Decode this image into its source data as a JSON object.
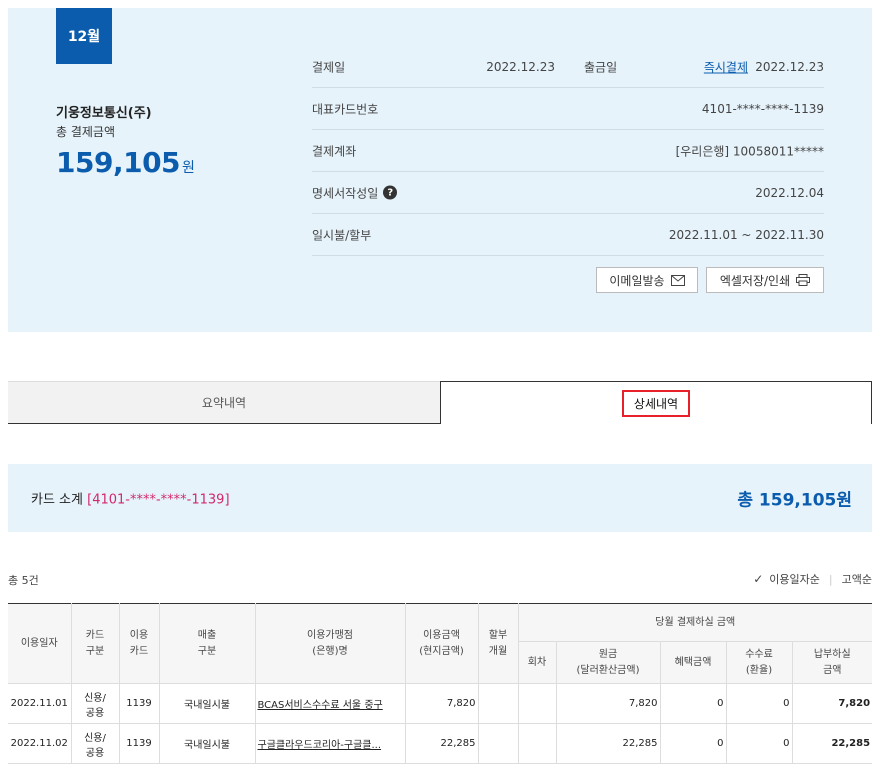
{
  "summary": {
    "month": "12월",
    "company": "기웅정보통신(주)",
    "total_label": "총 결제금액",
    "total_amount": "159,105",
    "total_unit": "원",
    "rows": {
      "pay_date_label": "결제일",
      "pay_date_value": "2022.12.23",
      "withdraw_label": "출금일",
      "withdraw_link": "즉시결제",
      "withdraw_value": "2022.12.23",
      "card_label": "대표카드번호",
      "card_value": "4101-****-****-1139",
      "account_label": "결제계좌",
      "account_value": "[우리은행] 10058011*****",
      "statement_label": "명세서작성일",
      "statement_value": "2022.12.04",
      "period_label": "일시불/할부",
      "period_value": "2022.11.01 ~ 2022.11.30"
    },
    "email_button": "이메일발송",
    "excel_button": "엑셀저장/인쇄"
  },
  "tabs": {
    "summary": "요약내역",
    "detail": "상세내역"
  },
  "subtotal": {
    "title": "카드 소계",
    "card": "[4101-****-****-1139]",
    "amount": "총 159,105원"
  },
  "list": {
    "count": "총 5건",
    "sort_date": "이용일자순",
    "sort_amount": "고액순"
  },
  "table": {
    "headers": {
      "date": "이용일자",
      "card_type_1": "카드",
      "card_type_2": "구분",
      "use_card_1": "이용",
      "use_card_2": "카드",
      "sale_type_1": "매출",
      "sale_type_2": "구분",
      "merchant_1": "이용가맹점",
      "merchant_2": "(은행)명",
      "amount_1": "이용금액",
      "amount_2": "(현지금액)",
      "installment_1": "할부",
      "installment_2": "개월",
      "monthly": "당월 결제하실 금액",
      "round": "회차",
      "principal_1": "원금",
      "principal_2": "(달러환산금액)",
      "benefit": "혜택금액",
      "fee_1": "수수료",
      "fee_2": "(환율)",
      "due_1": "납부하실",
      "due_2": "금액"
    },
    "rows": [
      {
        "date": "2022.11.01",
        "card_type": "신용/\n공용",
        "card_type_1": "신용/",
        "card_type_2": "공용",
        "use_card": "1139",
        "sale_type": "국내일시불",
        "merchant": "BCAS서비스수수료 서울 중구",
        "amount": "7,820",
        "installment": "",
        "round": "",
        "principal": "7,820",
        "benefit": "0",
        "fee": "0",
        "due": "7,820"
      },
      {
        "date": "2022.11.02",
        "card_type_1": "신용/",
        "card_type_2": "공용",
        "use_card": "1139",
        "sale_type": "국내일시불",
        "merchant": "구글클라우드코리아-구글클...",
        "amount": "22,285",
        "installment": "",
        "round": "",
        "principal": "22,285",
        "benefit": "0",
        "fee": "0",
        "due": "22,285"
      }
    ]
  }
}
